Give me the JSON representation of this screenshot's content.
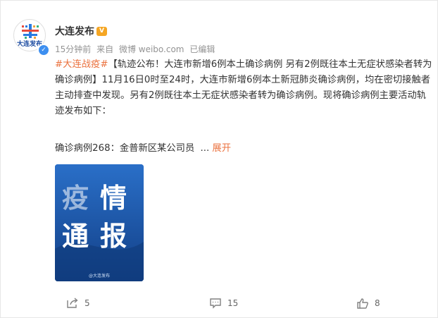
{
  "post": {
    "username": "大连发布",
    "avatar_text": "大连发布",
    "vip_badge": "V",
    "verified_mark": "✓",
    "meta": {
      "time": "15分钟前",
      "source_prefix": "来自",
      "source_app": "微博 weibo.com",
      "edited": "已编辑"
    },
    "hashtag": "#大连战疫#",
    "body_text": "【轨迹公布！大连市新增6例本土确诊病例 另有2例既往本土无症状感染者转为确诊病例】11月16日0时至24时，大连市新增6例本土新冠肺炎确诊病例，均在密切接触者主动排查中发现。另有2例既往本土无症状感染者转为确诊病例。现将确诊病例主要活动轨迹发布如下：",
    "case_line": "确诊病例268：金普新区某公司员",
    "ellipsis": "...",
    "expand_label": "展开",
    "image": {
      "char1": "疫",
      "char2": "情",
      "char3": "通",
      "char4": "报",
      "footer": "@大连发布",
      "bg_color": "#1b5db0"
    }
  },
  "actions": {
    "share_count": "5",
    "comment_count": "15",
    "like_count": "8"
  },
  "colors": {
    "accent": "#eb7340",
    "meta_gray": "#939393",
    "verify_blue": "#3d8ff0"
  }
}
